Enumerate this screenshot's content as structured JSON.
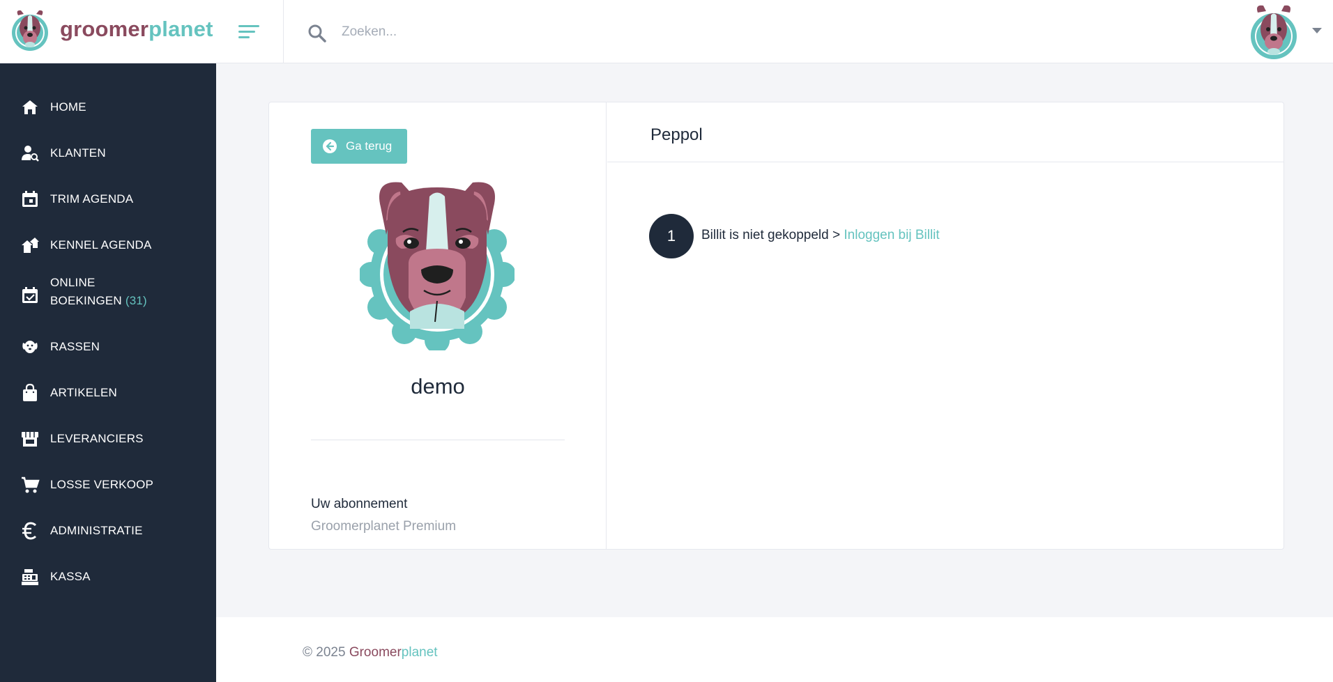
{
  "brand": {
    "name_part1": "groomer",
    "name_part2": "planet",
    "color_primary": "#8a4a5e",
    "color_accent": "#65c3bf",
    "logo_icon": "dog-logo-icon"
  },
  "topbar": {
    "menu_icon": "hamburger-menu-icon",
    "search_icon": "search-icon",
    "search_placeholder": "Zoeken...",
    "search_value": "",
    "avatar_icon": "dog-avatar-icon",
    "dropdown_icon": "caret-down-icon"
  },
  "sidebar": {
    "background": "#1f2a3a",
    "items": [
      {
        "label": "HOME",
        "icon": "home-icon"
      },
      {
        "label": "KLANTEN",
        "icon": "user-search-icon"
      },
      {
        "label": "TRIM AGENDA",
        "icon": "calendar-icon"
      },
      {
        "label": "KENNEL AGENDA",
        "icon": "houses-icon"
      },
      {
        "label": "ONLINE",
        "label_line2": "BOEKINGEN",
        "count": "(31)",
        "icon": "calendar-check-icon"
      },
      {
        "label": "RASSEN",
        "icon": "dog-face-icon"
      },
      {
        "label": "ARTIKELEN",
        "icon": "shopping-bag-icon"
      },
      {
        "label": "LEVERANCIERS",
        "icon": "store-icon"
      },
      {
        "label": "LOSSE VERKOOP",
        "icon": "cart-icon"
      },
      {
        "label": "ADMINISTRATIE",
        "icon": "euro-icon"
      },
      {
        "label": "KASSA",
        "icon": "cash-register-icon"
      }
    ]
  },
  "profile": {
    "back_label": "Ga terug",
    "back_icon": "arrow-left-circle-icon",
    "name": "demo",
    "subscription_label": "Uw abonnement",
    "subscription_value": "Groomerplanet Premium"
  },
  "panel": {
    "title": "Peppol",
    "step_number": "1",
    "step_text": "Billit is niet gekoppeld > ",
    "step_link": "Inloggen bij Billit"
  },
  "footer": {
    "copyright": "© 2025 ",
    "brand_part1": "Groomer",
    "brand_part2": "planet"
  }
}
